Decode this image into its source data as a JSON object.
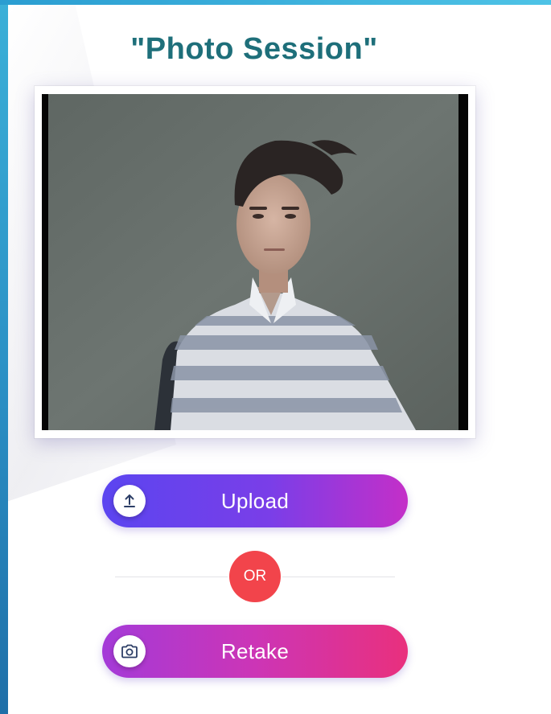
{
  "page": {
    "title": "\"Photo Session\""
  },
  "photo": {
    "subject": "webcam-capture"
  },
  "actions": {
    "upload_label": "Upload",
    "or_label": "OR",
    "retake_label": "Retake"
  },
  "icons": {
    "upload": "upload-arrow-icon",
    "retake": "camera-icon"
  },
  "colors": {
    "title": "#1e6f7a",
    "upload_gradient_start": "#5b45f0",
    "upload_gradient_end": "#c42fc8",
    "retake_gradient_start": "#a43ad8",
    "retake_gradient_end": "#e9307d",
    "or_badge": "#f2444b",
    "accent_bar": "#2a9dd1"
  }
}
